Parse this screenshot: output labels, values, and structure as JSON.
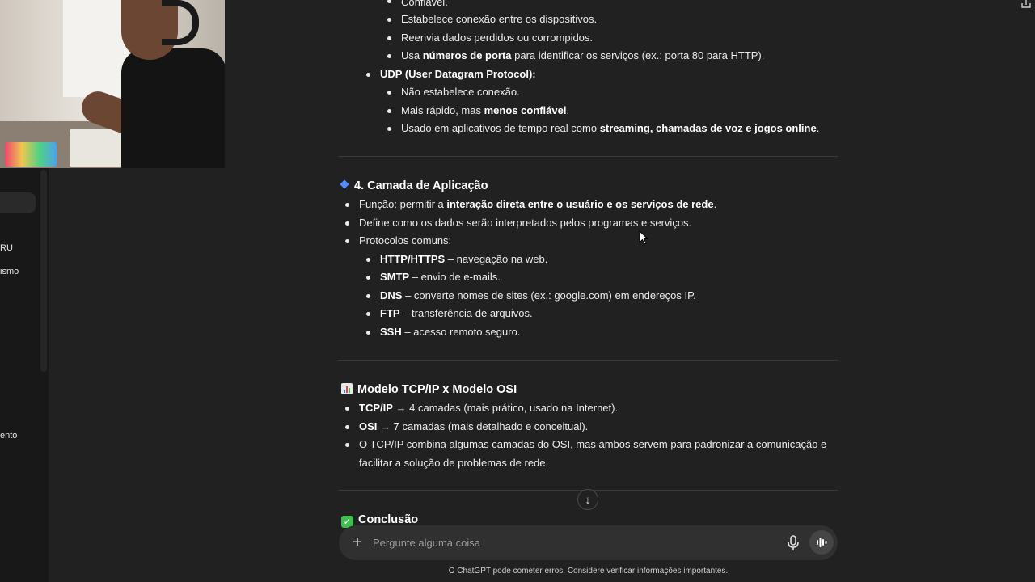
{
  "sidebar": {
    "items": [
      {
        "label": "RU"
      },
      {
        "label": "ismo"
      },
      {
        "label": "ento"
      }
    ]
  },
  "tcp_section": {
    "items": [
      {
        "text": "Confiável."
      },
      {
        "text": "Estabelece conexão entre os dispositivos."
      },
      {
        "text": "Reenvia dados perdidos ou corrompidos."
      },
      {
        "pre": "Usa ",
        "bold": "números de porta",
        "post": " para identificar os serviços (ex.: porta 80 para HTTP)."
      }
    ],
    "udp_title": "UDP (User Datagram Protocol):",
    "udp_items": [
      {
        "pre": "Não estabelece conexão.",
        "bold": "",
        "post": ""
      },
      {
        "pre": "Mais rápido, mas ",
        "bold": "menos confiável",
        "post": "."
      },
      {
        "pre": "Usado em aplicativos de tempo real como ",
        "bold": "streaming, chamadas de voz e jogos online",
        "post": "."
      }
    ]
  },
  "app_layer": {
    "title": "4. Camada de Aplicação",
    "items": [
      {
        "pre": "Função: permitir a ",
        "bold": "interação direta entre o usuário e os serviços de rede",
        "post": "."
      },
      {
        "pre": "Define como os dados serão interpretados pelos programas e serviços.",
        "bold": "",
        "post": ""
      },
      {
        "pre": "Protocolos comuns:",
        "bold": "",
        "post": ""
      }
    ],
    "protocols": [
      {
        "name": "HTTP/HTTPS",
        "desc": " – navegação na web."
      },
      {
        "name": "SMTP",
        "desc": " – envio de e-mails."
      },
      {
        "name": "DNS",
        "desc": " – converte nomes de sites (ex.: google.com) em endereços IP."
      },
      {
        "name": "FTP",
        "desc": " – transferência de arquivos."
      },
      {
        "name": "SSH",
        "desc": " – acesso remoto seguro."
      }
    ]
  },
  "compare": {
    "title": "Modelo TCP/IP x Modelo OSI",
    "items": [
      {
        "bold": "TCP/IP",
        "post": " → 4 camadas (mais prático, usado na Internet)."
      },
      {
        "bold": "OSI",
        "post": " → 7 camadas (mais detalhado e conceitual)."
      }
    ],
    "para_line1": "O TCP/IP combina algumas camadas do OSI, mas ambos servem para padronizar a comunicação e",
    "para_line2": "facilitar a solução de problemas de rede."
  },
  "conclusion": {
    "title": "Conclusão"
  },
  "composer": {
    "placeholder": "Pergunte alguma coisa"
  },
  "footer": {
    "note": "O ChatGPT pode cometer erros. Considere verificar informações importantes."
  },
  "icons": {
    "section_diamond": "blue-diamond-icon",
    "chart": "bar-chart-icon",
    "check": "check-mark-icon",
    "scroll_down": "arrow-down-icon",
    "plus": "plus-icon",
    "mic": "microphone-icon",
    "voice": "voice-mode-icon"
  },
  "colors": {
    "background": "#212121",
    "sidebar": "#181818",
    "accent_blue": "#4f8cff",
    "check_green": "#3fbf4f"
  }
}
